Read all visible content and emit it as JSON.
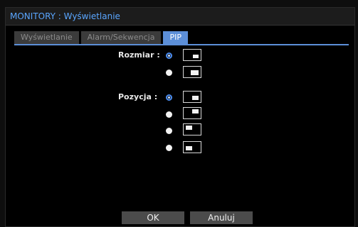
{
  "window": {
    "title": "MONITORY : Wyświetlanie"
  },
  "tabs": [
    {
      "label": "Wyświetlanie",
      "active": false
    },
    {
      "label": "Alarm/Sekwencja",
      "active": false
    },
    {
      "label": "PIP",
      "active": true
    }
  ],
  "pip": {
    "size_label": "Rozmiar :",
    "position_label": "Pozycja :",
    "size_options": [
      {
        "name": "small",
        "selected": true
      },
      {
        "name": "large",
        "selected": false
      }
    ],
    "position_options": [
      {
        "name": "bottom-right",
        "selected": true
      },
      {
        "name": "top-right",
        "selected": false
      },
      {
        "name": "top-left",
        "selected": false
      },
      {
        "name": "bottom-left",
        "selected": false
      }
    ]
  },
  "buttons": {
    "ok": "OK",
    "cancel": "Anuluj"
  },
  "colors": {
    "accent": "#5c8fd8",
    "title_text": "#5aa6ff",
    "tab_inactive": "#3b3b3b",
    "button": "#4b4b4b"
  }
}
